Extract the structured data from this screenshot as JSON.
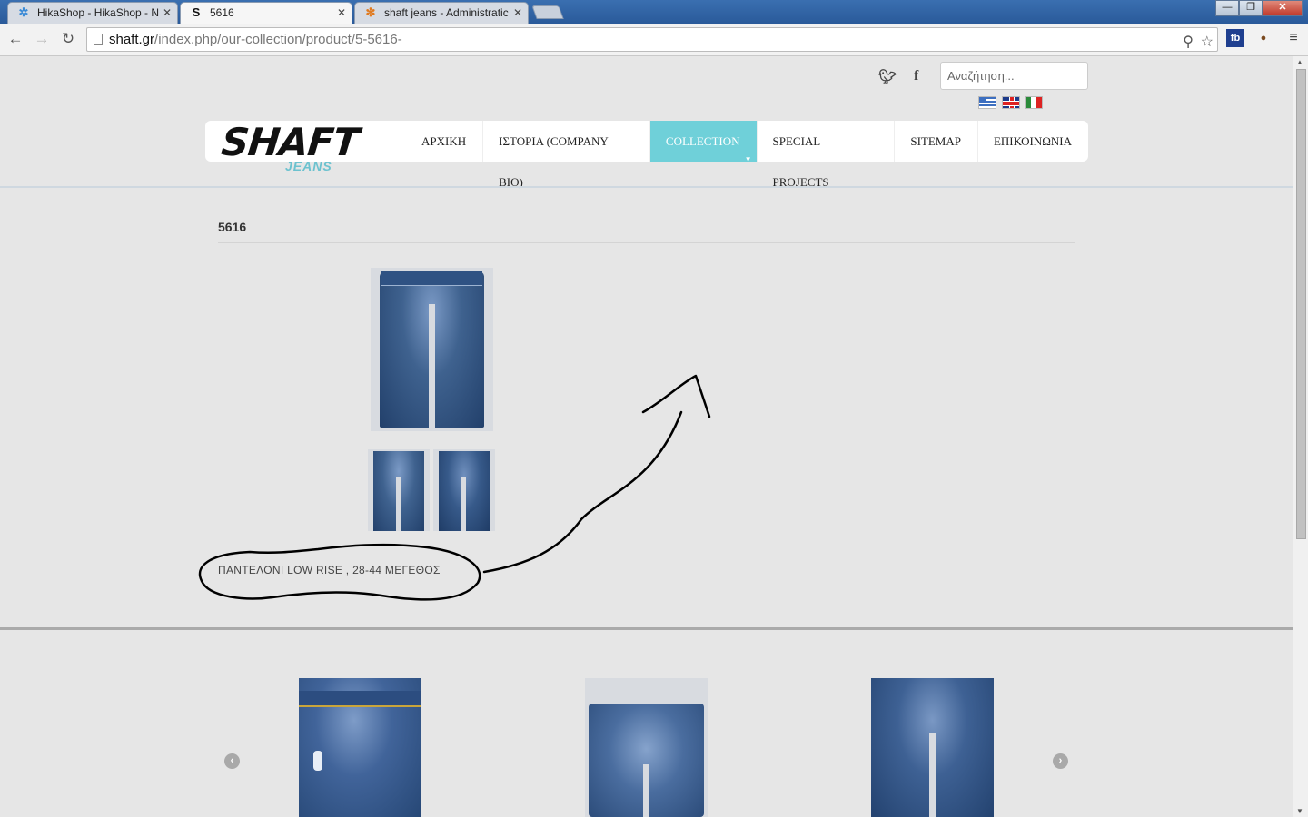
{
  "browser": {
    "tabs": [
      {
        "title": "HikaShop - HikaShop - N",
        "icon": "hikashop-icon"
      },
      {
        "title": "5616",
        "icon": "shaft-s-icon"
      },
      {
        "title": "shaft jeans - Administratic",
        "icon": "joomla-icon"
      }
    ],
    "url_host": "shaft.gr",
    "url_path": "/index.php/our-collection/product/5-5616-"
  },
  "header": {
    "search_placeholder": "Αναζήτηση...",
    "logo_main": "SHAFT",
    "logo_sub": "JEANS",
    "menu": [
      {
        "label": "ΑΡΧΙΚΗ"
      },
      {
        "label": "ΙΣΤΟΡΙΑ (COMPANY BIO)"
      },
      {
        "label": "COLLECTION",
        "active": true
      },
      {
        "label": "SPECIAL PROJECTS"
      },
      {
        "label": "SITEMAP"
      },
      {
        "label": "ΕΠΙΚΟΙΝΩΝΙΑ"
      }
    ],
    "accent_color": "#6fd0d9"
  },
  "product": {
    "title": "5616",
    "description": "ΠΑΝΤΕΛΟΝΙ LOW RISE , 28-44 ΜΕΓΕΘΟΣ"
  }
}
